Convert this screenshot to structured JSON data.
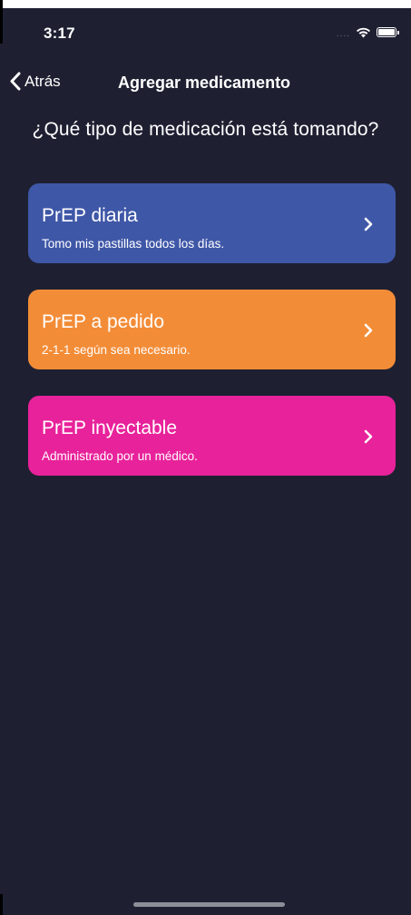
{
  "status_bar": {
    "time": "3:17",
    "signal": "....",
    "wifi_icon": "wifi-icon",
    "battery_icon": "battery-icon"
  },
  "nav": {
    "back_label": "Atrás",
    "back_icon": "chevron-left-icon",
    "title": "Agregar medicamento"
  },
  "question": "¿Qué tipo de medicación está tomando?",
  "options": [
    {
      "title": "PrEP diaria",
      "subtitle": "Tomo mis pastillas todos los días.",
      "color": "#3f57a7",
      "icon": "chevron-right-icon"
    },
    {
      "title": "PrEP a pedido",
      "subtitle": "2-1-1 según sea necesario.",
      "color": "#f38c37",
      "icon": "chevron-right-icon"
    },
    {
      "title": "PrEP inyectable",
      "subtitle": "Administrado por un médico.",
      "color": "#e8229a",
      "icon": "chevron-right-icon"
    }
  ],
  "colors": {
    "background": "#1e2032",
    "text": "#ffffff",
    "home_indicator": "#8c8e98"
  }
}
